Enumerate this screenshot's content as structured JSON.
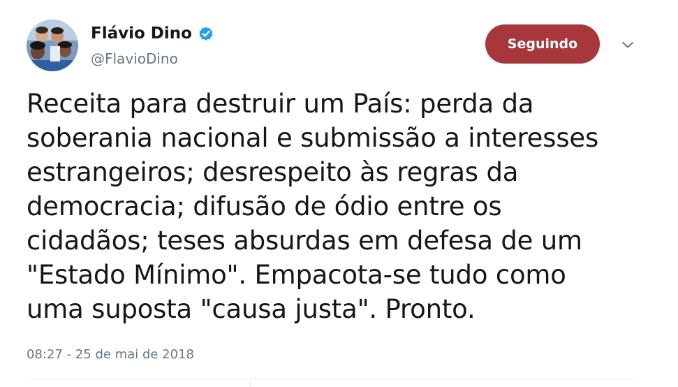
{
  "tweet": {
    "author": {
      "display_name": "Flávio Dino",
      "handle": "@FlavioDino",
      "verified": true,
      "avatar_icon": "profile-photo",
      "verified_icon": "verified-badge-icon"
    },
    "follow_button_label": "Seguindo",
    "menu_icon": "chevron-down-icon",
    "text_lines": [
      "Receita para destruir um País: perda da",
      "soberania nacional e submissão a interesses",
      "estrangeiros; desrespeito às regras da",
      "democracia; difusão de ódio entre os",
      "cidadãos; teses absurdas em defesa de um",
      "\"Estado Mínimo\". Empacota-se tudo como",
      "uma suposta \"causa justa\". Pronto."
    ],
    "timestamp": "08:27 - 25 de mai de 2018"
  },
  "colors": {
    "follow_button_bg": "#a7373c",
    "verified_badge": "#1da1f2",
    "muted_text": "#657786",
    "main_text": "#14171a",
    "divider": "#e6ecf0"
  }
}
